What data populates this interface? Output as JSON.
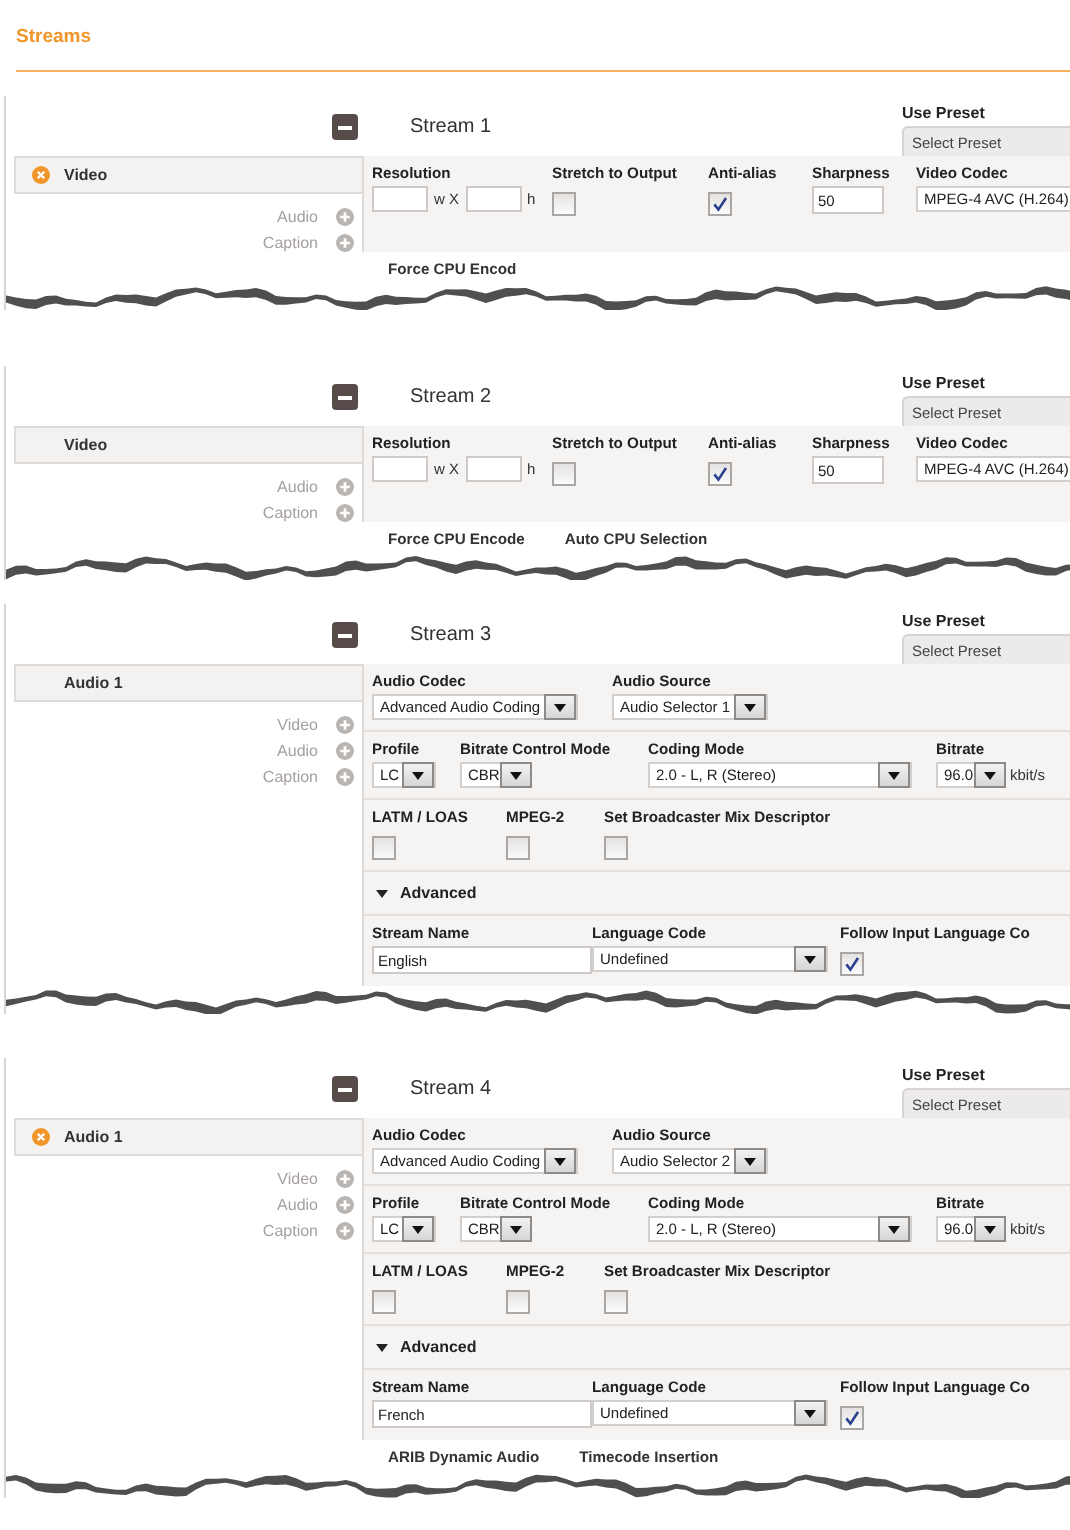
{
  "page": {
    "title": "Streams"
  },
  "streams": [
    {
      "title": "Stream 1",
      "preset": {
        "label": "Use Preset",
        "value": "Select Preset"
      },
      "sidebar": {
        "header": "Video",
        "removable": true,
        "add_links": [
          "Audio",
          "Caption"
        ]
      },
      "rows": [
        {
          "kind": "fields",
          "fields": [
            {
              "kind": "resolution",
              "label": "Resolution",
              "separator": "w X",
              "unit": "h"
            },
            {
              "kind": "checkbox",
              "label": "Stretch to Output",
              "checked": false
            },
            {
              "kind": "checkbox",
              "label": "Anti-alias",
              "checked": true
            },
            {
              "kind": "text",
              "label": "Sharpness",
              "value": "50"
            },
            {
              "kind": "select",
              "label": "Video Codec",
              "value": "MPEG-4 AVC (H.264)"
            }
          ]
        }
      ],
      "cut_labels": [
        "Force CPU Encod"
      ]
    },
    {
      "title": "Stream 2",
      "preset": {
        "label": "Use Preset",
        "value": "Select Preset"
      },
      "sidebar": {
        "header": "Video",
        "removable": false,
        "add_links": [
          "Audio",
          "Caption"
        ]
      },
      "rows": [
        {
          "kind": "fields",
          "fields": [
            {
              "kind": "resolution",
              "label": "Resolution",
              "separator": "w X",
              "unit": "h"
            },
            {
              "kind": "checkbox",
              "label": "Stretch to Output",
              "checked": false
            },
            {
              "kind": "checkbox",
              "label": "Anti-alias",
              "checked": true
            },
            {
              "kind": "text",
              "label": "Sharpness",
              "value": "50"
            },
            {
              "kind": "select",
              "label": "Video Codec",
              "value": "MPEG-4 AVC (H.264)"
            }
          ]
        }
      ],
      "cut_labels": [
        "Force CPU Encode",
        "Auto CPU Selection"
      ]
    },
    {
      "title": "Stream 3",
      "preset": {
        "label": "Use Preset",
        "value": "Select Preset"
      },
      "sidebar": {
        "header": "Audio 1",
        "removable": false,
        "add_links": [
          "Video",
          "Audio",
          "Caption"
        ]
      },
      "rows": [
        {
          "kind": "fields",
          "fields": [
            {
              "kind": "select",
              "label": "Audio Codec",
              "value": "Advanced Audio Coding"
            },
            {
              "kind": "select",
              "label": "Audio Source",
              "value": "Audio Selector 1"
            }
          ]
        },
        {
          "kind": "fields",
          "fields": [
            {
              "kind": "select",
              "label": "Profile",
              "value": "LC"
            },
            {
              "kind": "select",
              "label": "Bitrate Control Mode",
              "value": "CBR"
            },
            {
              "kind": "select",
              "label": "Coding Mode",
              "value": "2.0 - L, R (Stereo)"
            },
            {
              "kind": "select",
              "label": "Bitrate",
              "value": "96.0",
              "unit": "kbit/s"
            }
          ]
        },
        {
          "kind": "fields",
          "fields": [
            {
              "kind": "checkbox",
              "label": "LATM / LOAS",
              "checked": false
            },
            {
              "kind": "checkbox",
              "label": "MPEG-2",
              "checked": false
            },
            {
              "kind": "checkbox",
              "label": "Set Broadcaster Mix Descriptor",
              "checked": false
            }
          ]
        },
        {
          "kind": "toggle",
          "label": "Advanced",
          "expanded": true
        },
        {
          "kind": "fields",
          "fields": [
            {
              "kind": "text",
              "label": "Stream Name",
              "value": "English"
            },
            {
              "kind": "select",
              "label": "Language Code",
              "value": "Undefined"
            },
            {
              "kind": "checkbox",
              "label": "Follow Input Language Co",
              "checked": true
            }
          ]
        }
      ]
    },
    {
      "title": "Stream 4",
      "preset": {
        "label": "Use Preset",
        "value": "Select Preset"
      },
      "sidebar": {
        "header": "Audio 1",
        "removable": true,
        "add_links": [
          "Video",
          "Audio",
          "Caption"
        ]
      },
      "rows": [
        {
          "kind": "fields",
          "fields": [
            {
              "kind": "select",
              "label": "Audio Codec",
              "value": "Advanced Audio Coding"
            },
            {
              "kind": "select",
              "label": "Audio Source",
              "value": "Audio Selector 2"
            }
          ]
        },
        {
          "kind": "fields",
          "fields": [
            {
              "kind": "select",
              "label": "Profile",
              "value": "LC"
            },
            {
              "kind": "select",
              "label": "Bitrate Control Mode",
              "value": "CBR"
            },
            {
              "kind": "select",
              "label": "Coding Mode",
              "value": "2.0 - L, R (Stereo)"
            },
            {
              "kind": "select",
              "label": "Bitrate",
              "value": "96.0",
              "unit": "kbit/s"
            }
          ]
        },
        {
          "kind": "fields",
          "fields": [
            {
              "kind": "checkbox",
              "label": "LATM / LOAS",
              "checked": false
            },
            {
              "kind": "checkbox",
              "label": "MPEG-2",
              "checked": false
            },
            {
              "kind": "checkbox",
              "label": "Set Broadcaster Mix Descriptor",
              "checked": false
            }
          ]
        },
        {
          "kind": "toggle",
          "label": "Advanced",
          "expanded": true
        },
        {
          "kind": "fields",
          "fields": [
            {
              "kind": "text",
              "label": "Stream Name",
              "value": "French"
            },
            {
              "kind": "select",
              "label": "Language Code",
              "value": "Undefined"
            },
            {
              "kind": "checkbox",
              "label": "Follow Input Language Co",
              "checked": true
            }
          ]
        }
      ],
      "cut_labels": [
        "ARIB Dynamic Audio",
        "Timecode Insertion"
      ]
    }
  ]
}
